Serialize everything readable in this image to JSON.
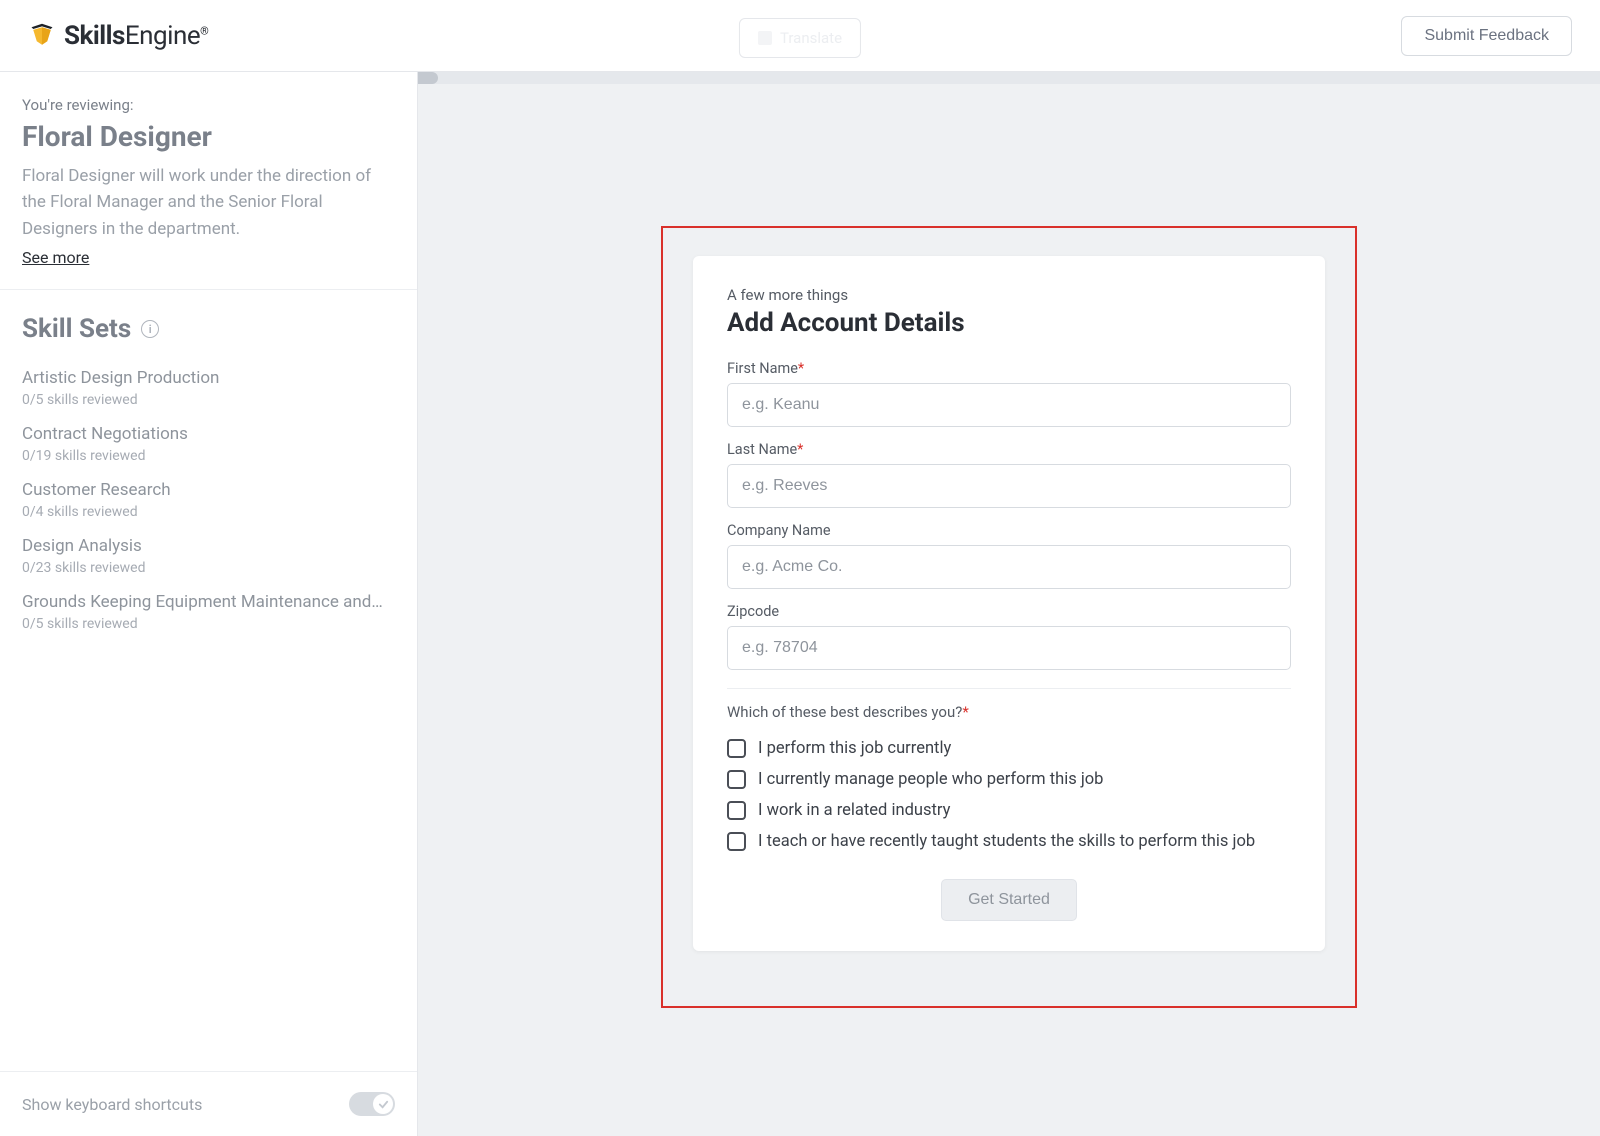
{
  "header": {
    "brand_primary": "Skills",
    "brand_secondary": "Engine",
    "brand_reg": "®",
    "center_button": "Translate",
    "submit_feedback": "Submit Feedback"
  },
  "sidebar": {
    "review_label": "You're reviewing:",
    "review_title": "Floral Designer",
    "review_desc": "Floral Designer will work under the direction of the Floral Manager and the Senior Floral Designers in the department.",
    "see_more": "See more",
    "skillsets_heading": "Skill Sets",
    "skills": [
      {
        "name": "Artistic Design Production",
        "meta": "0/5 skills reviewed"
      },
      {
        "name": "Contract Negotiations",
        "meta": "0/19 skills reviewed"
      },
      {
        "name": "Customer Research",
        "meta": "0/4 skills reviewed"
      },
      {
        "name": "Design Analysis",
        "meta": "0/23 skills reviewed"
      },
      {
        "name": "Grounds Keeping Equipment Maintenance and…",
        "meta": "0/5 skills reviewed"
      }
    ],
    "kb_shortcuts": "Show keyboard shortcuts"
  },
  "modal": {
    "eyebrow": "A few more things",
    "title": "Add Account Details",
    "fields": {
      "first_name": {
        "label": "First Name",
        "placeholder": "e.g. Keanu"
      },
      "last_name": {
        "label": "Last Name",
        "placeholder": "e.g. Reeves"
      },
      "company": {
        "label": "Company Name",
        "placeholder": "e.g. Acme Co."
      },
      "zipcode": {
        "label": "Zipcode",
        "placeholder": "e.g. 78704"
      }
    },
    "question": "Which of these best describes you?",
    "options": [
      "I perform this job currently",
      "I currently manage people who perform this job",
      "I work in a related industry",
      "I teach or have recently taught students the skills to perform this job"
    ],
    "get_started": "Get Started"
  }
}
